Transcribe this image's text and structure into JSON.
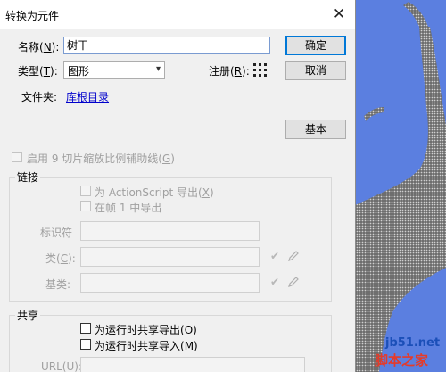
{
  "dialog": {
    "title": "转换为元件",
    "close_glyph": "✕",
    "name_label": "名称(",
    "name_key": "N",
    "name_suffix": "):",
    "name_value": "树干",
    "type_label": "类型(",
    "type_key": "T",
    "type_suffix": "):",
    "type_value": "图形",
    "register_label": "注册(",
    "register_key": "R",
    "register_suffix": "):",
    "folder_label": "文件夹:",
    "folder_value": "库根目录",
    "ok_label": "确定",
    "cancel_label": "取消",
    "basic_label": "基本",
    "nine_slice_label": "启用 9 切片缩放比例辅助线(",
    "nine_slice_key": "G",
    "nine_slice_suffix": ")"
  },
  "linkage": {
    "title": "链接",
    "export_as_label": "为 ActionScript 导出(",
    "export_as_key": "X",
    "export_as_suffix": ")",
    "export_frame_label": "在帧 1 中导出",
    "identifier_label": "标识符",
    "class_label": "类(",
    "class_key": "C",
    "class_suffix": "):",
    "base_class_label": "基类:"
  },
  "sharing": {
    "title": "共享",
    "export_runtime_label": "为运行时共享导出(",
    "export_runtime_key": "O",
    "export_runtime_suffix": ")",
    "import_runtime_label": "为运行时共享导入(",
    "import_runtime_key": "M",
    "import_runtime_suffix": ")",
    "url_label": "URL(U):"
  },
  "watermark": {
    "url": "jb51.net",
    "name": "脚本之家"
  },
  "icons": [
    "close-icon",
    "chevron-down-icon",
    "registration-grid-icon",
    "checkmark-icon",
    "pencil-icon"
  ],
  "colors": {
    "desktop_blue": "#5b7fe0",
    "dialog_bg": "#f0f0f0",
    "accent": "#0078d7",
    "link": "#0000cc"
  }
}
